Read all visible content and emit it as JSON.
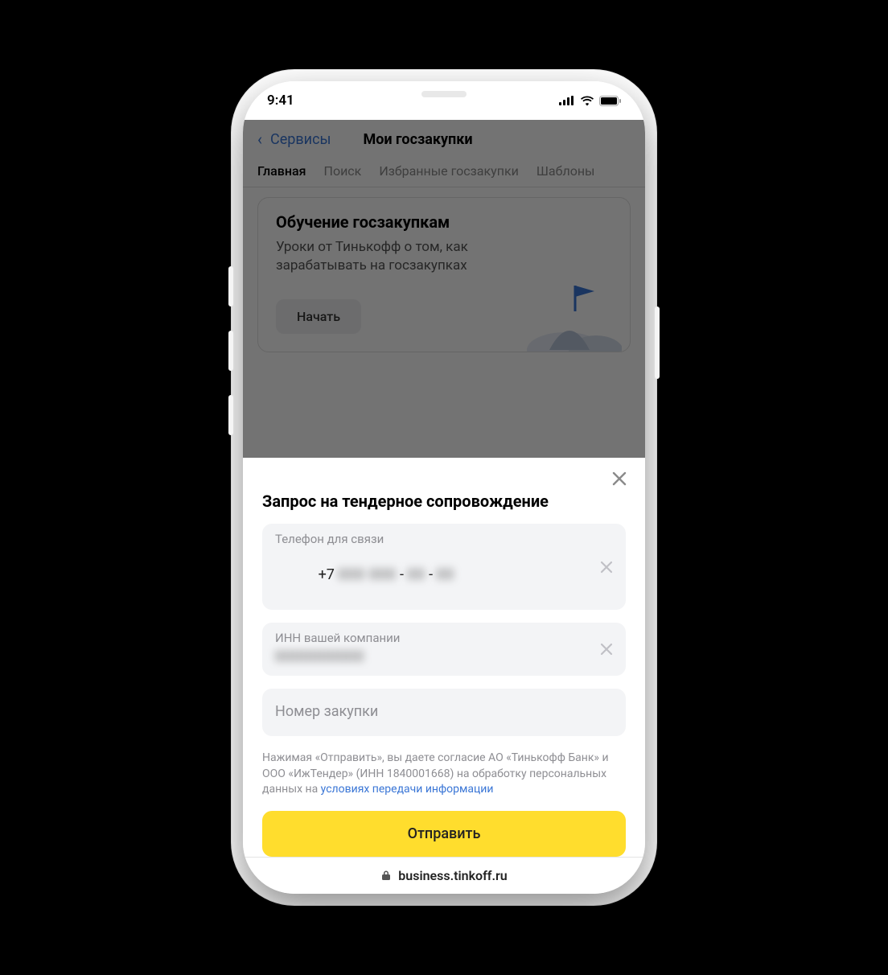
{
  "statusbar": {
    "time": "9:41"
  },
  "nav": {
    "back_label": "Сервисы",
    "title": "Мои госзакупки"
  },
  "tabs": [
    "Главная",
    "Поиск",
    "Избранные госзакупки",
    "Шаблоны"
  ],
  "card": {
    "title": "Обучение госзакупкам",
    "subtitle": "Уроки от Тинькофф о том, как зарабатывать на госзакупках",
    "button": "Начать"
  },
  "sheet": {
    "title": "Запрос на тендерное сопровождение",
    "phone": {
      "label": "Телефон для связи",
      "value": "+7         -     -"
    },
    "inn": {
      "label": "ИНН вашей компании",
      "value": "           "
    },
    "number": {
      "placeholder": "Номер закупки"
    },
    "legal_text": "Нажимая «Отправить», вы даете согласие АО «Тинькофф Банк» и ООО «ИжТендер» (ИНН 1840001668) на обработку персональных данных на ",
    "legal_link": "условиях передачи информации",
    "submit": "Отправить"
  },
  "address_bar": "business.tinkoff.ru"
}
